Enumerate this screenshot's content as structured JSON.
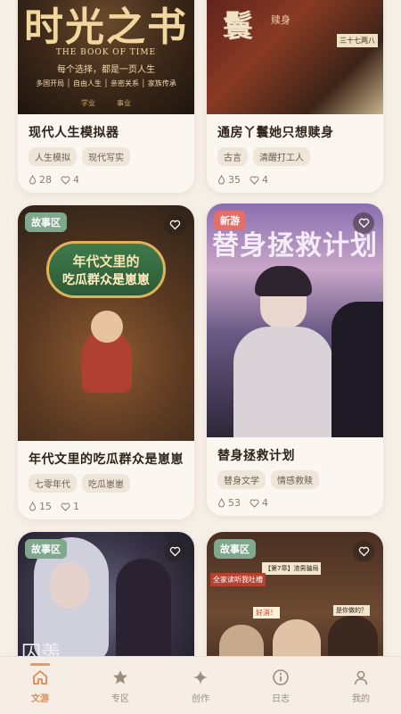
{
  "colors": {
    "accent": "#e08a55",
    "badge_story": "#7fa88c",
    "badge_new": "#e26f6a",
    "background": "#f6efe6"
  },
  "cards": [
    {
      "title": "现代人生模拟器",
      "tags": [
        "人生模拟",
        "现代写实"
      ],
      "views": "28",
      "likes": "4",
      "cover_text": {
        "main": "时光之书",
        "sub": "THE BOOK OF TIME",
        "tagline": "每个选择，都是一页人生",
        "menu": "多国开局 │ 自由人生 │ 亲密关系 │ 家族传承",
        "bottom": "学业　　　事业"
      }
    },
    {
      "title": "通房丫鬟她只想赎身",
      "tags": [
        "古言",
        "清醒打工人"
      ],
      "views": "35",
      "likes": "4",
      "cover_text": {
        "main": "鬟",
        "side": "三十七两八",
        "note": "赎身"
      }
    },
    {
      "title": "年代文里的吃瓜群众是崽崽",
      "tags": [
        "七零年代",
        "吃瓜崽崽"
      ],
      "views": "15",
      "likes": "1",
      "badge": "故事区",
      "cover_text": {
        "line1": "年代文里的",
        "line2": "吃瓜群众是崽崽"
      }
    },
    {
      "title": "替身拯救计划",
      "tags": [
        "替身文学",
        "情感救赎"
      ],
      "views": "53",
      "likes": "4",
      "badge": "新游",
      "cover_text": {
        "main": "替身拯救计划"
      }
    },
    {
      "badge": "故事区",
      "cover_text": {
        "bottom": "囚羡"
      }
    },
    {
      "badge": "故事区",
      "cover_text": {
        "a": "【第7章】渣男骗局",
        "b": "全家读听我吐槽",
        "c": "好消！",
        "d": "是你做的？"
      }
    }
  ],
  "tabbar": [
    {
      "label": "文游",
      "icon": "home-icon",
      "active": true
    },
    {
      "label": "专区",
      "icon": "star-icon",
      "active": false
    },
    {
      "label": "创作",
      "icon": "sparkle-icon",
      "active": false
    },
    {
      "label": "日志",
      "icon": "info-circle-icon",
      "active": false
    },
    {
      "label": "我的",
      "icon": "person-icon",
      "active": false
    }
  ]
}
